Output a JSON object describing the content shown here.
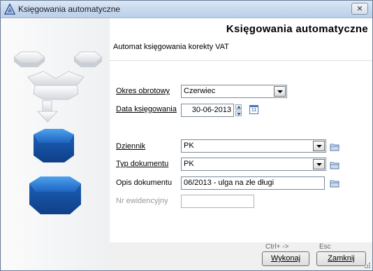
{
  "window": {
    "title": "Księgowania automatyczne",
    "close_label": "✕",
    "app_icon": "triangle-app-icon"
  },
  "header": {
    "title": "Księgowania automatyczne",
    "subtitle": "Automat księgowania korekty VAT"
  },
  "form": {
    "period": {
      "label": "Okres obrotowy",
      "value": "Czerwiec"
    },
    "date": {
      "label": "Data księgowania",
      "value": "30-06-2013"
    },
    "journal": {
      "label": "Dziennik",
      "value": "PK"
    },
    "doc_type": {
      "label": "Typ dokumentu",
      "value": "PK"
    },
    "doc_desc": {
      "label": "Opis dokumentu",
      "value": "06/2013 - ulga na złe długi"
    },
    "reg_no": {
      "label": "Nr ewidencyjny",
      "value": ""
    }
  },
  "calendar_icon_text": "11",
  "footer": {
    "execute_shortcut": "Ctrl+ ->",
    "close_shortcut": "Esc",
    "execute_label": "Wykonaj",
    "close_label": "Zamknij"
  },
  "colors": {
    "accent_blue": "#2f7fd6",
    "title_bar": "#c7d8ee"
  }
}
